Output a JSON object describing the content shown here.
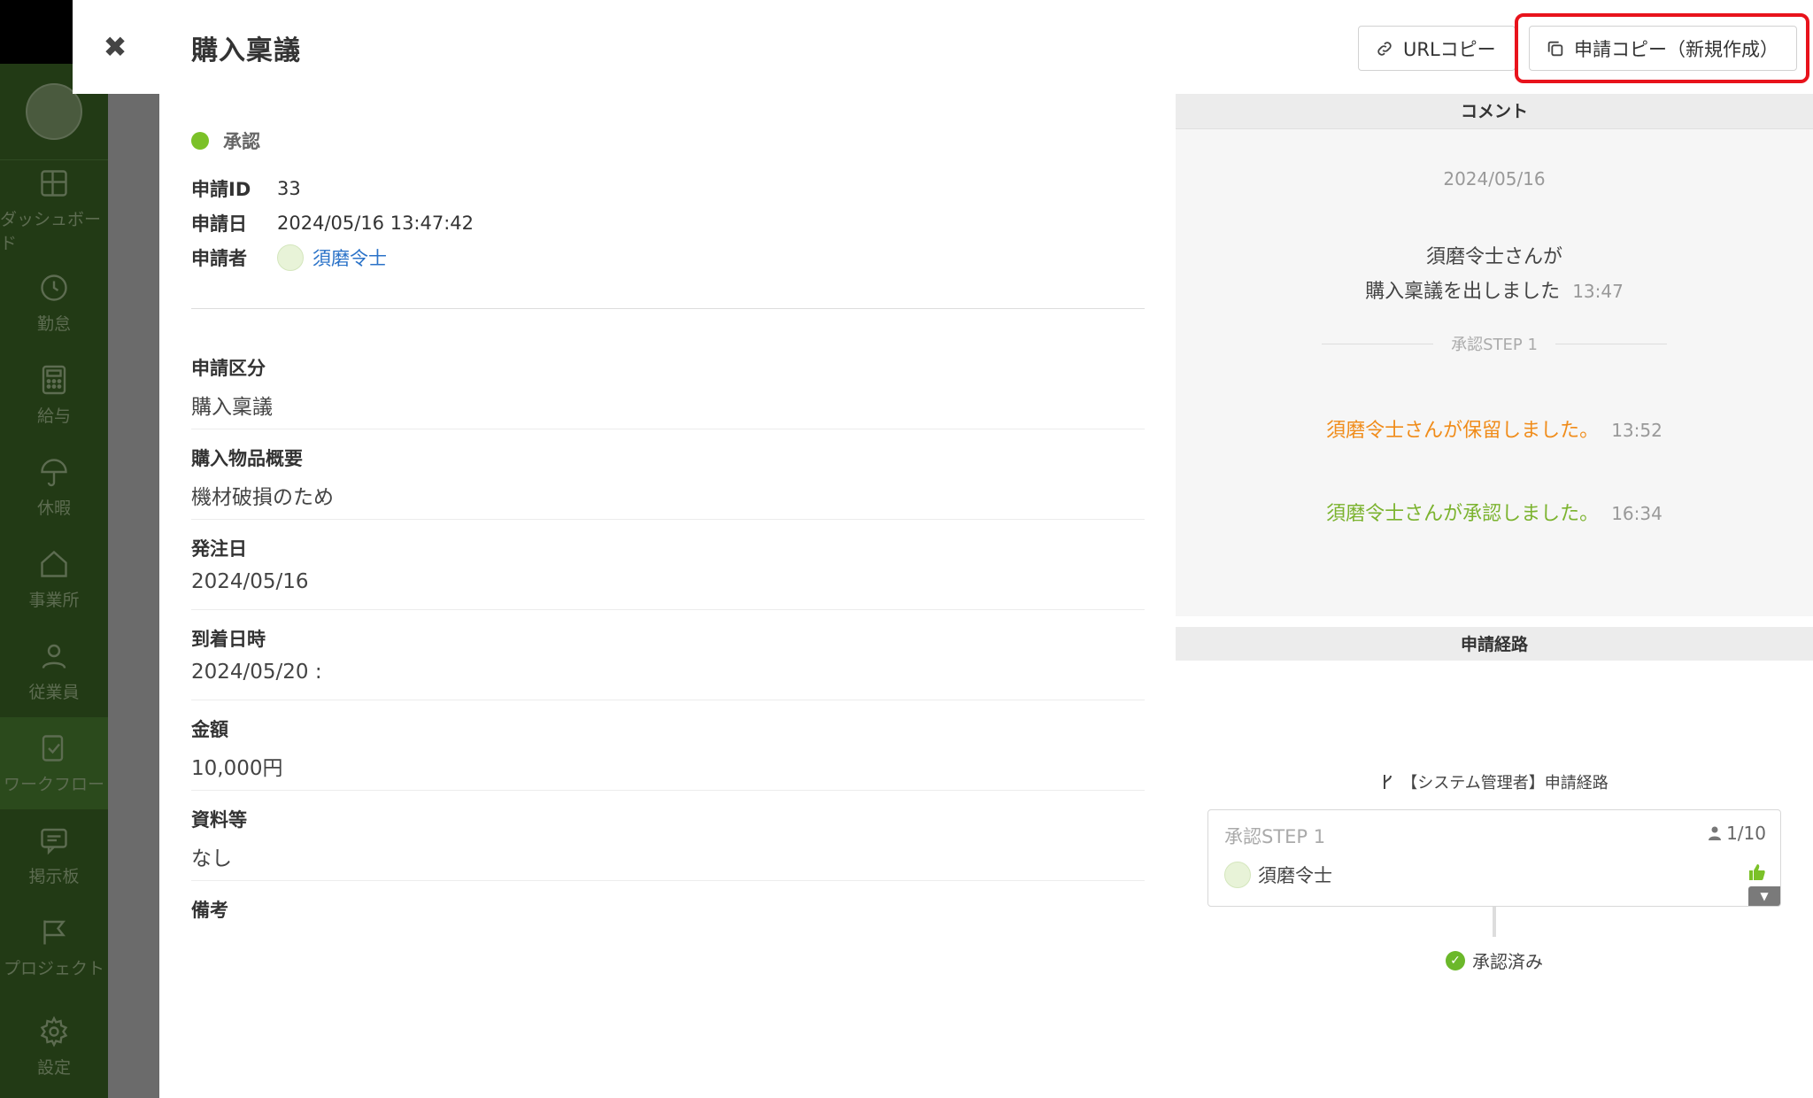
{
  "sidebar": {
    "items": [
      {
        "label": "ダッシュボード",
        "icon": "dashboard-icon"
      },
      {
        "label": "勤怠",
        "icon": "clock-icon"
      },
      {
        "label": "給与",
        "icon": "calculator-icon"
      },
      {
        "label": "休暇",
        "icon": "umbrella-icon"
      },
      {
        "label": "事業所",
        "icon": "home-icon"
      },
      {
        "label": "従業員",
        "icon": "user-icon"
      },
      {
        "label": "ワークフロー",
        "icon": "workflow-icon"
      },
      {
        "label": "掲示板",
        "icon": "message-icon"
      },
      {
        "label": "プロジェクト",
        "icon": "flag-icon"
      },
      {
        "label": "設定",
        "icon": "gear-icon"
      }
    ]
  },
  "header": {
    "title": "購入稟議",
    "url_copy_label": "URLコピー",
    "request_copy_label": "申請コピー（新規作成）"
  },
  "main": {
    "status": "承認",
    "meta": {
      "id_label": "申請ID",
      "id_value": "33",
      "date_label": "申請日",
      "date_value": "2024/05/16 13:47:42",
      "applicant_label": "申請者",
      "applicant_value": "須磨令士"
    },
    "fields": [
      {
        "label": "申請区分",
        "value": "購入稟議"
      },
      {
        "label": "購入物品概要",
        "value": "機材破損のため"
      },
      {
        "label": "発注日",
        "value": "2024/05/16"
      },
      {
        "label": "到着日時",
        "value": "2024/05/20 :"
      },
      {
        "label": "金額",
        "value": "10,000円"
      },
      {
        "label": "資料等",
        "value": "なし"
      },
      {
        "label": "備考",
        "value": ""
      }
    ]
  },
  "comments": {
    "header": "コメント",
    "date": "2024/05/16",
    "submit_line1": "須磨令士さんが",
    "submit_line2": "購入稟議を出しました",
    "submit_time": "13:47",
    "step_divider": "承認STEP 1",
    "hold_text": "須磨令士さんが保留しました。",
    "hold_time": "13:52",
    "approve_text": "須磨令士さんが承認しました。",
    "approve_time": "16:34"
  },
  "route": {
    "header": "申請経路",
    "name": "【システム管理者】申請経路",
    "step_title": "承認STEP 1",
    "step_count": "1/10",
    "approver": "須磨令士",
    "approved_label": "承認済み"
  },
  "colors": {
    "accent_red": "#e8131c",
    "status_green": "#7bc128",
    "hold_orange": "#f08c1a",
    "link_blue": "#2a72c8"
  }
}
